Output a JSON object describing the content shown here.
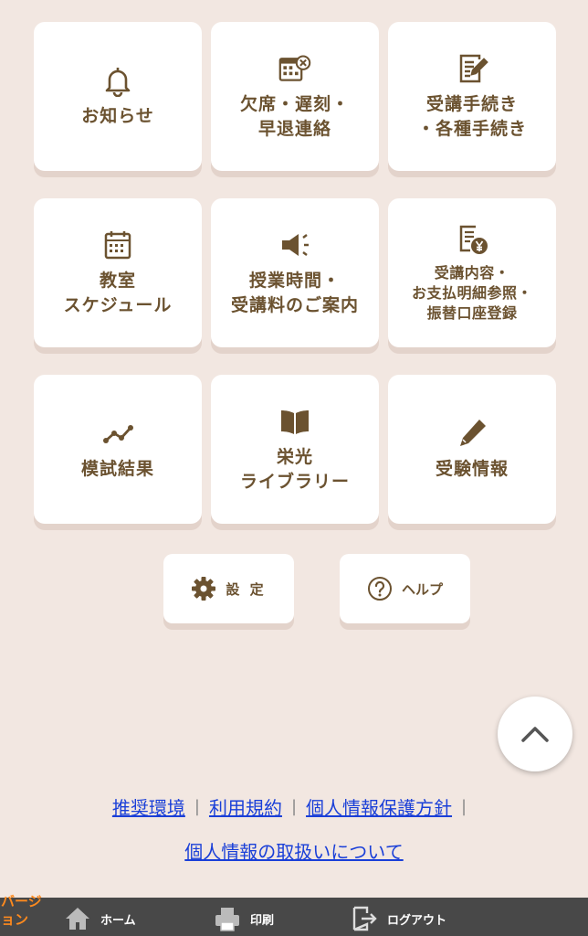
{
  "menu": {
    "tiles": [
      {
        "name": "oshirase",
        "icon": "bell-icon",
        "label": "お知らせ"
      },
      {
        "name": "absence",
        "icon": "calendar-cancel-icon",
        "label": "欠席・遅刻・\n早退連絡"
      },
      {
        "name": "procedures",
        "icon": "document-edit-icon",
        "label": "受講手続き\n・各種手続き"
      },
      {
        "name": "schedule",
        "icon": "calendar-icon",
        "label": "教室\nスケジュール"
      },
      {
        "name": "class-time",
        "icon": "megaphone-icon",
        "label": "授業時間・\n受講料のご案内"
      },
      {
        "name": "payment",
        "icon": "receipt-yen-icon",
        "label": "受講内容・\nお支払明細参照・\n振替口座登録"
      },
      {
        "name": "mock-exam",
        "icon": "line-chart-icon",
        "label": "模試結果"
      },
      {
        "name": "library",
        "icon": "book-icon",
        "label": "栄光\nライブラリー"
      },
      {
        "name": "exam-info",
        "icon": "pencil-icon",
        "label": "受験情報"
      }
    ],
    "settings_label": "設 定",
    "help_label": "ヘルプ"
  },
  "links": {
    "recommended": "推奨環境",
    "terms": "利用規約",
    "privacy_policy": "個人情報保護方針",
    "privacy_handling": "個人情報の取扱いについて",
    "separator": "|"
  },
  "footer": {
    "version": "バージョン",
    "home": "ホーム",
    "print": "印刷",
    "logout": "ログアウト"
  },
  "colors": {
    "background": "#f2e7e1",
    "icon": "#6b5230",
    "link": "#1a3fd8",
    "footer": "#484848",
    "version": "#ff8a1e"
  }
}
